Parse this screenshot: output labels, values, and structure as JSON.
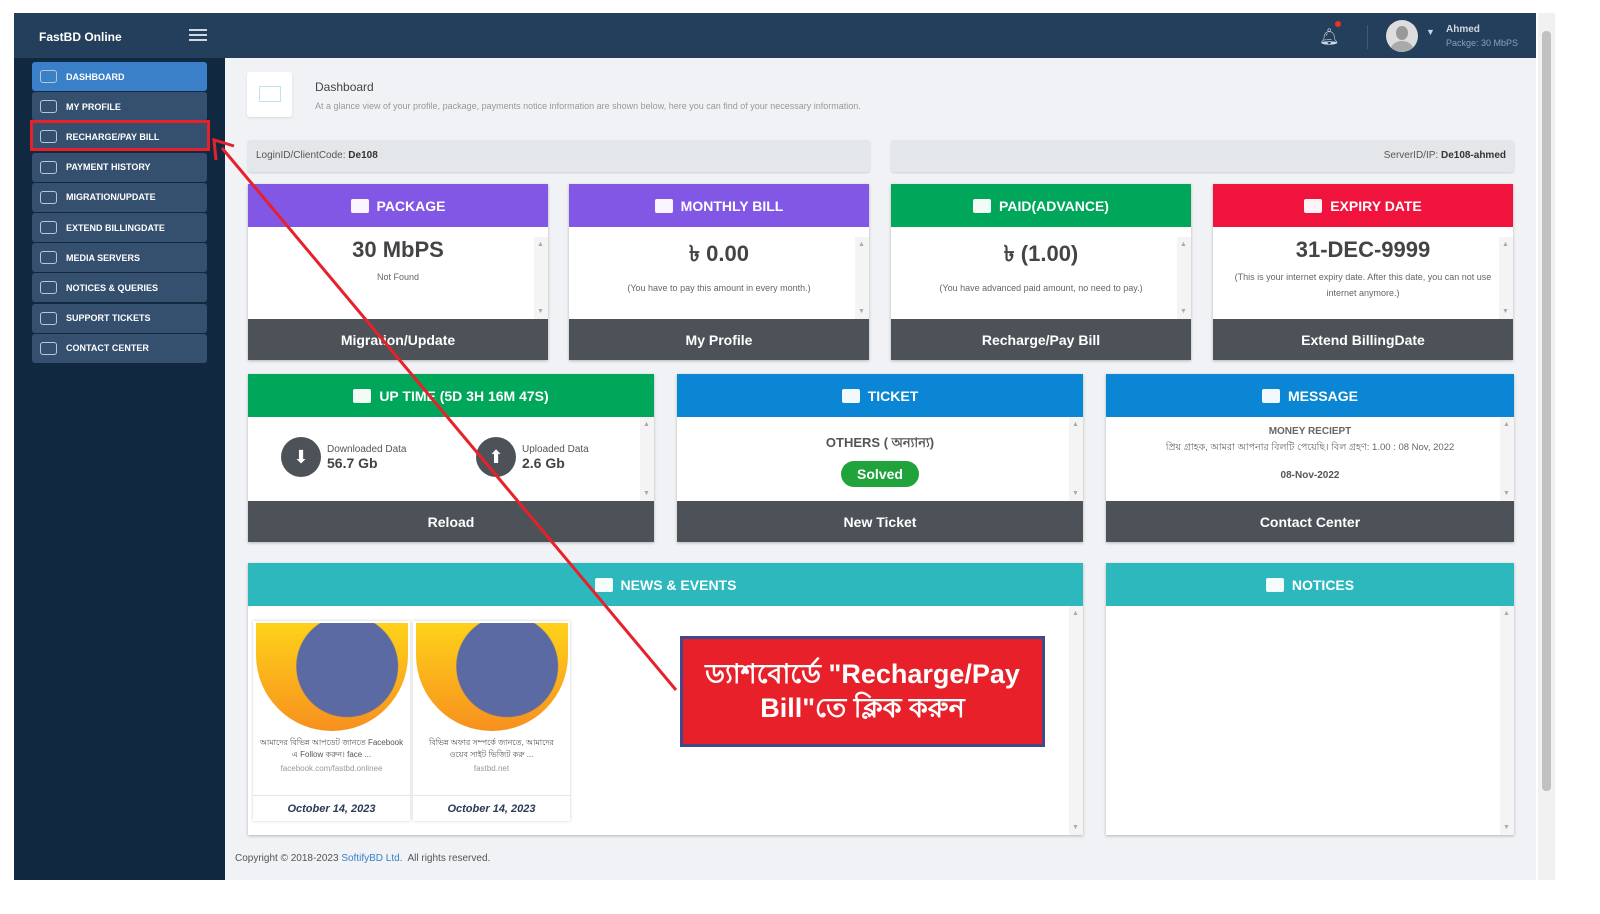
{
  "header": {
    "brand": "FastBD Online",
    "user_name": "Ahmed",
    "user_package": "Packge: 30 MbPS",
    "notification_dot_color": "#ee3322"
  },
  "sidebar": {
    "items": [
      {
        "label": "DASHBOARD",
        "icon": "presentation-icon",
        "active": true
      },
      {
        "label": "MY PROFILE",
        "icon": "user-circle-icon"
      },
      {
        "label": "RECHARGE/PAY BILL",
        "icon": "money-icon"
      },
      {
        "label": "PAYMENT HISTORY",
        "icon": "credit-card-icon"
      },
      {
        "label": "MIGRATION/UPDATE",
        "icon": "paper-plane-icon"
      },
      {
        "label": "EXTEND BILLINGDATE",
        "icon": "expand-icon"
      },
      {
        "label": "MEDIA SERVERS",
        "icon": "gamepad-icon"
      },
      {
        "label": "NOTICES & QUERIES",
        "icon": "info-icon"
      },
      {
        "label": "SUPPORT TICKETS",
        "icon": "save-icon"
      },
      {
        "label": "CONTACT CENTER",
        "icon": "headset-icon"
      }
    ]
  },
  "page": {
    "title": "Dashboard",
    "subtitle": "At a glance view of your profile, package, payments notice information are shown below, here you can find of your necessary information."
  },
  "info": {
    "login_label": "LoginID/ClientCode:",
    "login_value": "De108",
    "server_label": "ServerID/IP:",
    "server_value": "De108-ahmed"
  },
  "cards1": [
    {
      "title": "PACKAGE",
      "color": "#8257e6",
      "value": "30 MbPS",
      "note": "Not Found",
      "action": "Migration/Update",
      "icon": "cubes-icon"
    },
    {
      "title": "MONTHLY BILL",
      "color": "#8257e6",
      "value": "৳ 0.00",
      "note": "(You have to pay this amount in every month.)",
      "action": "My Profile",
      "icon": "money-bill-icon"
    },
    {
      "title": "PAID(ADVANCE)",
      "color": "#00a65a",
      "value": "৳ (1.00)",
      "note": "(You have advanced paid amount, no need to pay.)",
      "action": "Recharge/Pay Bill",
      "icon": "balance-scale-icon"
    },
    {
      "title": "EXPIRY DATE",
      "color": "#f0133d",
      "value": "31-DEC-9999",
      "note": "(This is your internet expiry date. After this date, you can not use internet anymore.)",
      "action": "Extend BillingDate",
      "icon": "calendar-icon"
    }
  ],
  "uptime": {
    "title": "UP TIME (5D 3H 16M 47S)",
    "color": "#00a65a",
    "downloaded_label": "Downloaded Data",
    "downloaded_value": "56.7 Gb",
    "uploaded_label": "Uploaded Data",
    "uploaded_value": "2.6 Gb",
    "action": "Reload"
  },
  "ticket": {
    "title": "TICKET",
    "color": "#0a86d4",
    "category": "OTHERS ( অন্যান্য)",
    "status": "Solved",
    "action": "New Ticket"
  },
  "message": {
    "title": "MESSAGE",
    "color": "#0a86d4",
    "heading": "MONEY RECIEPT",
    "text": "প্রিয় গ্রাহক, আমরা আপনার বিলটি পেয়েছি। বিল গ্রহণ: 1.00 : 08 Nov, 2022",
    "date": "08-Nov-2022",
    "action": "Contact Center"
  },
  "news": {
    "title": "NEWS & EVENTS",
    "color": "#2cb8bc",
    "items": [
      {
        "text": "আমাদের বিভিন্ন আপডেট জানতে Facebook এ Follow করুন। face ...",
        "url": "facebook.com/fastbd.onlinee",
        "date": "October 14, 2023"
      },
      {
        "text": "বিভিন্ন অফার সম্পর্কে জানতে, আমাদের ওয়েব সাইট ভিজিট করু ...",
        "url": "fastbd.net",
        "date": "October 14, 2023"
      }
    ]
  },
  "notices": {
    "title": "NOTICES",
    "color": "#2cb8bc"
  },
  "footer": {
    "prefix": "Copyright © 2018-2023",
    "company": "SoftifyBD Ltd.",
    "suffix": "All rights reserved."
  },
  "annotation": {
    "text": "ড্যাশবোর্ডে \"Recharge/Pay Bill\"তে ক্লিক করুন",
    "color": "#e8202a"
  }
}
